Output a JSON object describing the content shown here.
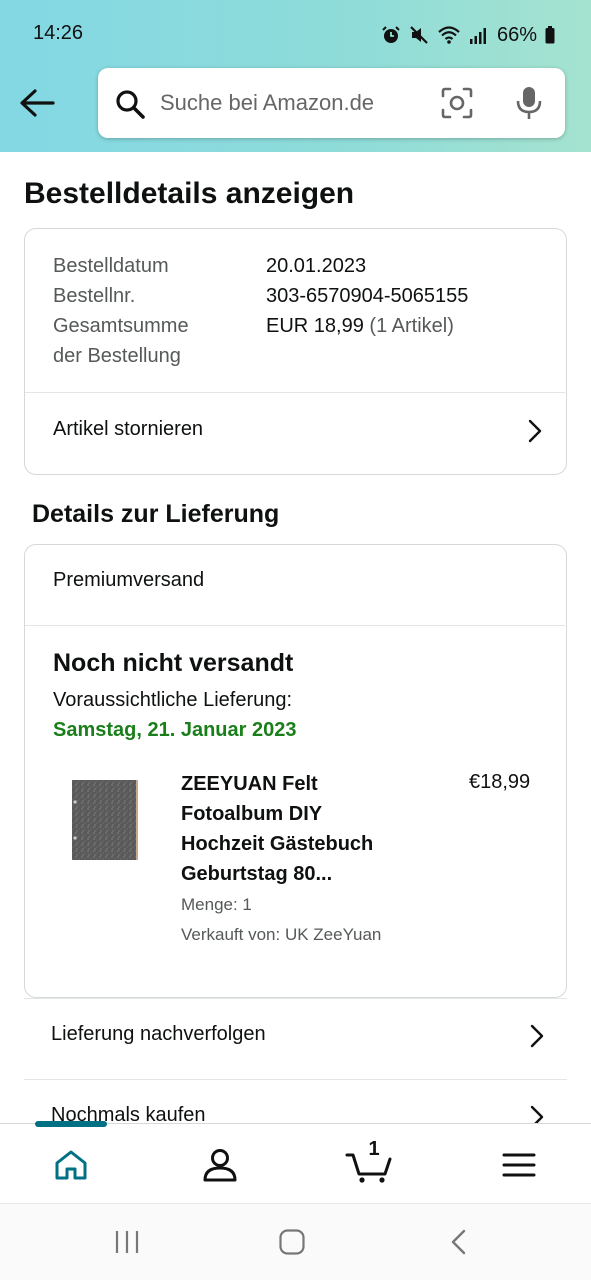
{
  "status_bar": {
    "time": "14:26",
    "battery": "66%",
    "icons": [
      "alarm-icon",
      "mute-icon",
      "wifi-icon",
      "signal-icon",
      "battery-icon"
    ]
  },
  "search": {
    "placeholder": "Suche bei Amazon.de"
  },
  "page_title": "Bestelldetails anzeigen",
  "order": {
    "date_label": "Bestelldatum",
    "date_value": "20.01.2023",
    "number_label": "Bestellnr.",
    "number_value": "303-6570904-5065155",
    "total_label_line1": "Gesamtsumme",
    "total_label_line2": "der Bestellung",
    "total_value": "EUR 18,99",
    "total_count": "(1 Artikel)",
    "cancel_label": "Artikel stornieren"
  },
  "delivery": {
    "section_title": "Details zur Lieferung",
    "shipping_type": "Premiumversand",
    "status": "Noch nicht versandt",
    "expected_label": "Voraussichtliche Lieferung:",
    "expected_date": "Samstag, 21. Januar 2023",
    "item": {
      "title_lines": [
        "ZEEYUAN Felt",
        "Fotoalbum DIY",
        "Hochzeit Gästebuch",
        "Geburtstag 80..."
      ],
      "price": "€18,99",
      "quantity": "Menge: 1",
      "seller": "Verkauft von: UK ZeeYuan"
    }
  },
  "actions": {
    "track": "Lieferung nachverfolgen",
    "buy_again": "Nochmals kaufen"
  },
  "bottom_nav": {
    "active": "home",
    "cart_count": "1",
    "accent_color": "#007185"
  },
  "colors": {
    "delivery_date": "#1a7f1a"
  }
}
